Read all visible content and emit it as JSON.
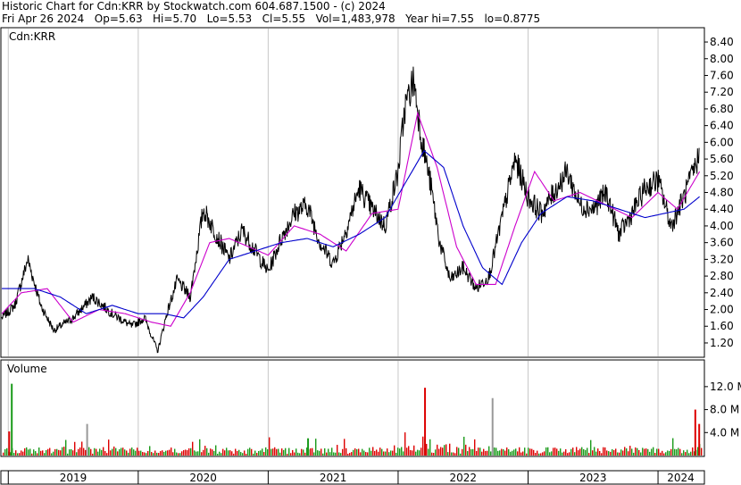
{
  "header": {
    "title": "Historic Chart for Cdn:KRR by Stockwatch.com 604.687.1500 - (c) 2024",
    "quote": "Fri Apr 26 2024   Op=5.63   Hi=5.70   Lo=5.53   Cl=5.55   Vol=1,483,978   Year hi=7.55   lo=0.8775"
  },
  "chart_data": [
    {
      "type": "line",
      "title": "Cdn:KRR",
      "ylim": [
        0.9,
        8.7
      ],
      "y_ticks": [
        "8.40",
        "8.00",
        "7.60",
        "7.20",
        "6.80",
        "6.40",
        "6.00",
        "5.60",
        "5.20",
        "4.80",
        "4.40",
        "4.00",
        "3.60",
        "3.20",
        "2.80",
        "2.40",
        "2.00",
        "1.60",
        "1.20"
      ],
      "x_categories": [
        "2019",
        "2020",
        "2021",
        "2022",
        "2023",
        "2024"
      ],
      "x_range": [
        2018.95,
        2024.35
      ],
      "grid": "vertical at year starts",
      "series": [
        {
          "color": "#000000",
          "style": "price",
          "x": [
            2018.95,
            2019.05,
            2019.15,
            2019.25,
            2019.35,
            2019.5,
            2019.65,
            2019.8,
            2019.95,
            2020.05,
            2020.15,
            2020.22,
            2020.3,
            2020.4,
            2020.5,
            2020.6,
            2020.7,
            2020.8,
            2020.9,
            2021.0,
            2021.1,
            2021.2,
            2021.3,
            2021.4,
            2021.5,
            2021.6,
            2021.7,
            2021.8,
            2021.9,
            2022.0,
            2022.05,
            2022.12,
            2022.18,
            2022.25,
            2022.32,
            2022.4,
            2022.5,
            2022.6,
            2022.7,
            2022.8,
            2022.9,
            2023.0,
            2023.1,
            2023.2,
            2023.3,
            2023.4,
            2023.5,
            2023.6,
            2023.7,
            2023.8,
            2023.9,
            2024.0,
            2024.1,
            2024.2,
            2024.32
          ],
          "y": [
            1.8,
            2.1,
            3.2,
            2.1,
            1.5,
            1.8,
            2.3,
            1.9,
            1.6,
            1.8,
            1.0,
            1.9,
            2.7,
            2.3,
            4.4,
            3.8,
            3.2,
            3.9,
            3.4,
            2.9,
            3.7,
            4.3,
            4.5,
            3.6,
            3.1,
            3.9,
            4.9,
            4.4,
            4.0,
            5.3,
            6.8,
            7.5,
            6.1,
            5.0,
            3.6,
            2.7,
            3.0,
            2.5,
            2.8,
            4.2,
            5.6,
            4.7,
            4.3,
            4.8,
            5.3,
            4.5,
            4.4,
            4.8,
            3.8,
            4.3,
            4.9,
            5.1,
            4.0,
            4.7,
            5.7
          ]
        },
        {
          "color": "#cc00cc",
          "style": "short moving average",
          "x": [
            2018.95,
            2019.1,
            2019.3,
            2019.5,
            2019.7,
            2019.9,
            2020.1,
            2020.25,
            2020.4,
            2020.55,
            2020.7,
            2020.85,
            2021.0,
            2021.2,
            2021.4,
            2021.6,
            2021.8,
            2022.0,
            2022.15,
            2022.3,
            2022.45,
            2022.6,
            2022.75,
            2022.9,
            2023.05,
            2023.2,
            2023.4,
            2023.6,
            2023.8,
            2024.0,
            2024.15,
            2024.32
          ],
          "y": [
            1.9,
            2.4,
            2.5,
            1.7,
            2.0,
            1.9,
            1.7,
            1.6,
            2.4,
            3.6,
            3.7,
            3.5,
            3.3,
            4.0,
            3.8,
            3.4,
            4.3,
            4.4,
            6.7,
            5.4,
            3.5,
            2.6,
            2.6,
            4.0,
            5.3,
            4.6,
            4.8,
            4.5,
            4.2,
            4.8,
            4.4,
            5.3
          ]
        },
        {
          "color": "#0000cc",
          "style": "long moving average",
          "x": [
            2018.95,
            2019.2,
            2019.4,
            2019.6,
            2019.8,
            2020.0,
            2020.2,
            2020.35,
            2020.5,
            2020.7,
            2020.9,
            2021.1,
            2021.3,
            2021.5,
            2021.7,
            2021.9,
            2022.05,
            2022.2,
            2022.35,
            2022.5,
            2022.65,
            2022.8,
            2022.95,
            2023.1,
            2023.3,
            2023.5,
            2023.7,
            2023.9,
            2024.05,
            2024.2,
            2024.32
          ],
          "y": [
            2.5,
            2.5,
            2.3,
            1.9,
            2.1,
            1.9,
            1.9,
            1.8,
            2.3,
            3.2,
            3.4,
            3.6,
            3.7,
            3.5,
            3.8,
            4.2,
            5.0,
            5.8,
            5.4,
            4.0,
            3.0,
            2.6,
            3.6,
            4.3,
            4.7,
            4.6,
            4.4,
            4.2,
            4.3,
            4.4,
            4.7
          ]
        }
      ]
    },
    {
      "type": "bar",
      "title": "Volume",
      "y_ticks": [
        "12.0 M",
        "8.0 M",
        "4.0 M"
      ],
      "ylim": [
        0,
        14
      ],
      "x_range": [
        2018.95,
        2024.35
      ],
      "colors": {
        "up": "#1a9a1a",
        "down": "#dd0000",
        "other": "#999999"
      },
      "spikes": [
        {
          "x": 2019.02,
          "value": 12.5,
          "color": "green"
        },
        {
          "x": 2019.0,
          "value": 4.2,
          "color": "red"
        },
        {
          "x": 2019.6,
          "value": 5.5,
          "color": "gray"
        },
        {
          "x": 2021.3,
          "value": 3.0,
          "color": "green"
        },
        {
          "x": 2022.2,
          "value": 11.8,
          "color": "red"
        },
        {
          "x": 2022.72,
          "value": 10.0,
          "color": "gray"
        },
        {
          "x": 2024.28,
          "value": 8.0,
          "color": "red"
        },
        {
          "x": 2024.31,
          "value": 5.5,
          "color": "red"
        }
      ]
    }
  ]
}
